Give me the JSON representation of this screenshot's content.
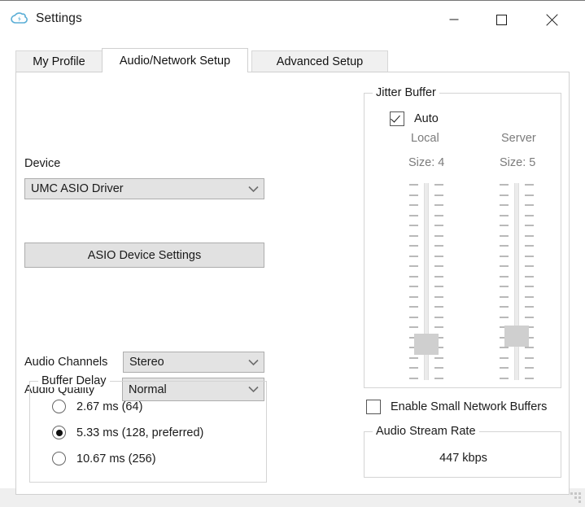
{
  "window": {
    "title": "Settings",
    "icon": "jamulus-cloud-note-icon",
    "controls": {
      "minimize": "minimize-icon",
      "maximize": "maximize-icon",
      "close": "close-icon"
    }
  },
  "tabs": [
    {
      "label": "My Profile",
      "selected": false
    },
    {
      "label": "Audio/Network Setup",
      "selected": true
    },
    {
      "label": "Advanced Setup",
      "selected": false
    }
  ],
  "device": {
    "label": "Device",
    "selected": "UMC ASIO Driver",
    "settings_button": "ASIO Device Settings"
  },
  "audio": {
    "channels_label": "Audio Channels",
    "channels_value": "Stereo",
    "quality_label": "Audio Quality",
    "quality_value": "Normal"
  },
  "buffer_delay": {
    "title": "Buffer Delay",
    "options": [
      {
        "label": "2.67 ms (64)",
        "selected": false
      },
      {
        "label": "5.33 ms (128, preferred)",
        "selected": true
      },
      {
        "label": "10.67 ms (256)",
        "selected": false
      }
    ]
  },
  "jitter_buffer": {
    "title": "Jitter Buffer",
    "auto_label": "Auto",
    "auto_checked": true,
    "local_label": "Local",
    "local_size": "Size: 4",
    "server_label": "Server",
    "server_size": "Size: 5"
  },
  "small_buffers": {
    "label": "Enable Small Network Buffers",
    "checked": false
  },
  "audio_stream_rate": {
    "title": "Audio Stream Rate",
    "value": "447 kbps"
  },
  "colors": {
    "window_bg": "#ffffff",
    "desktop_bg": "#efefef",
    "control_bg": "#e3e3e3",
    "border": "#adadad",
    "group_border": "#d4d4d4",
    "dim_text": "#7b7b7b",
    "accent_icon": "#5aaed6"
  }
}
